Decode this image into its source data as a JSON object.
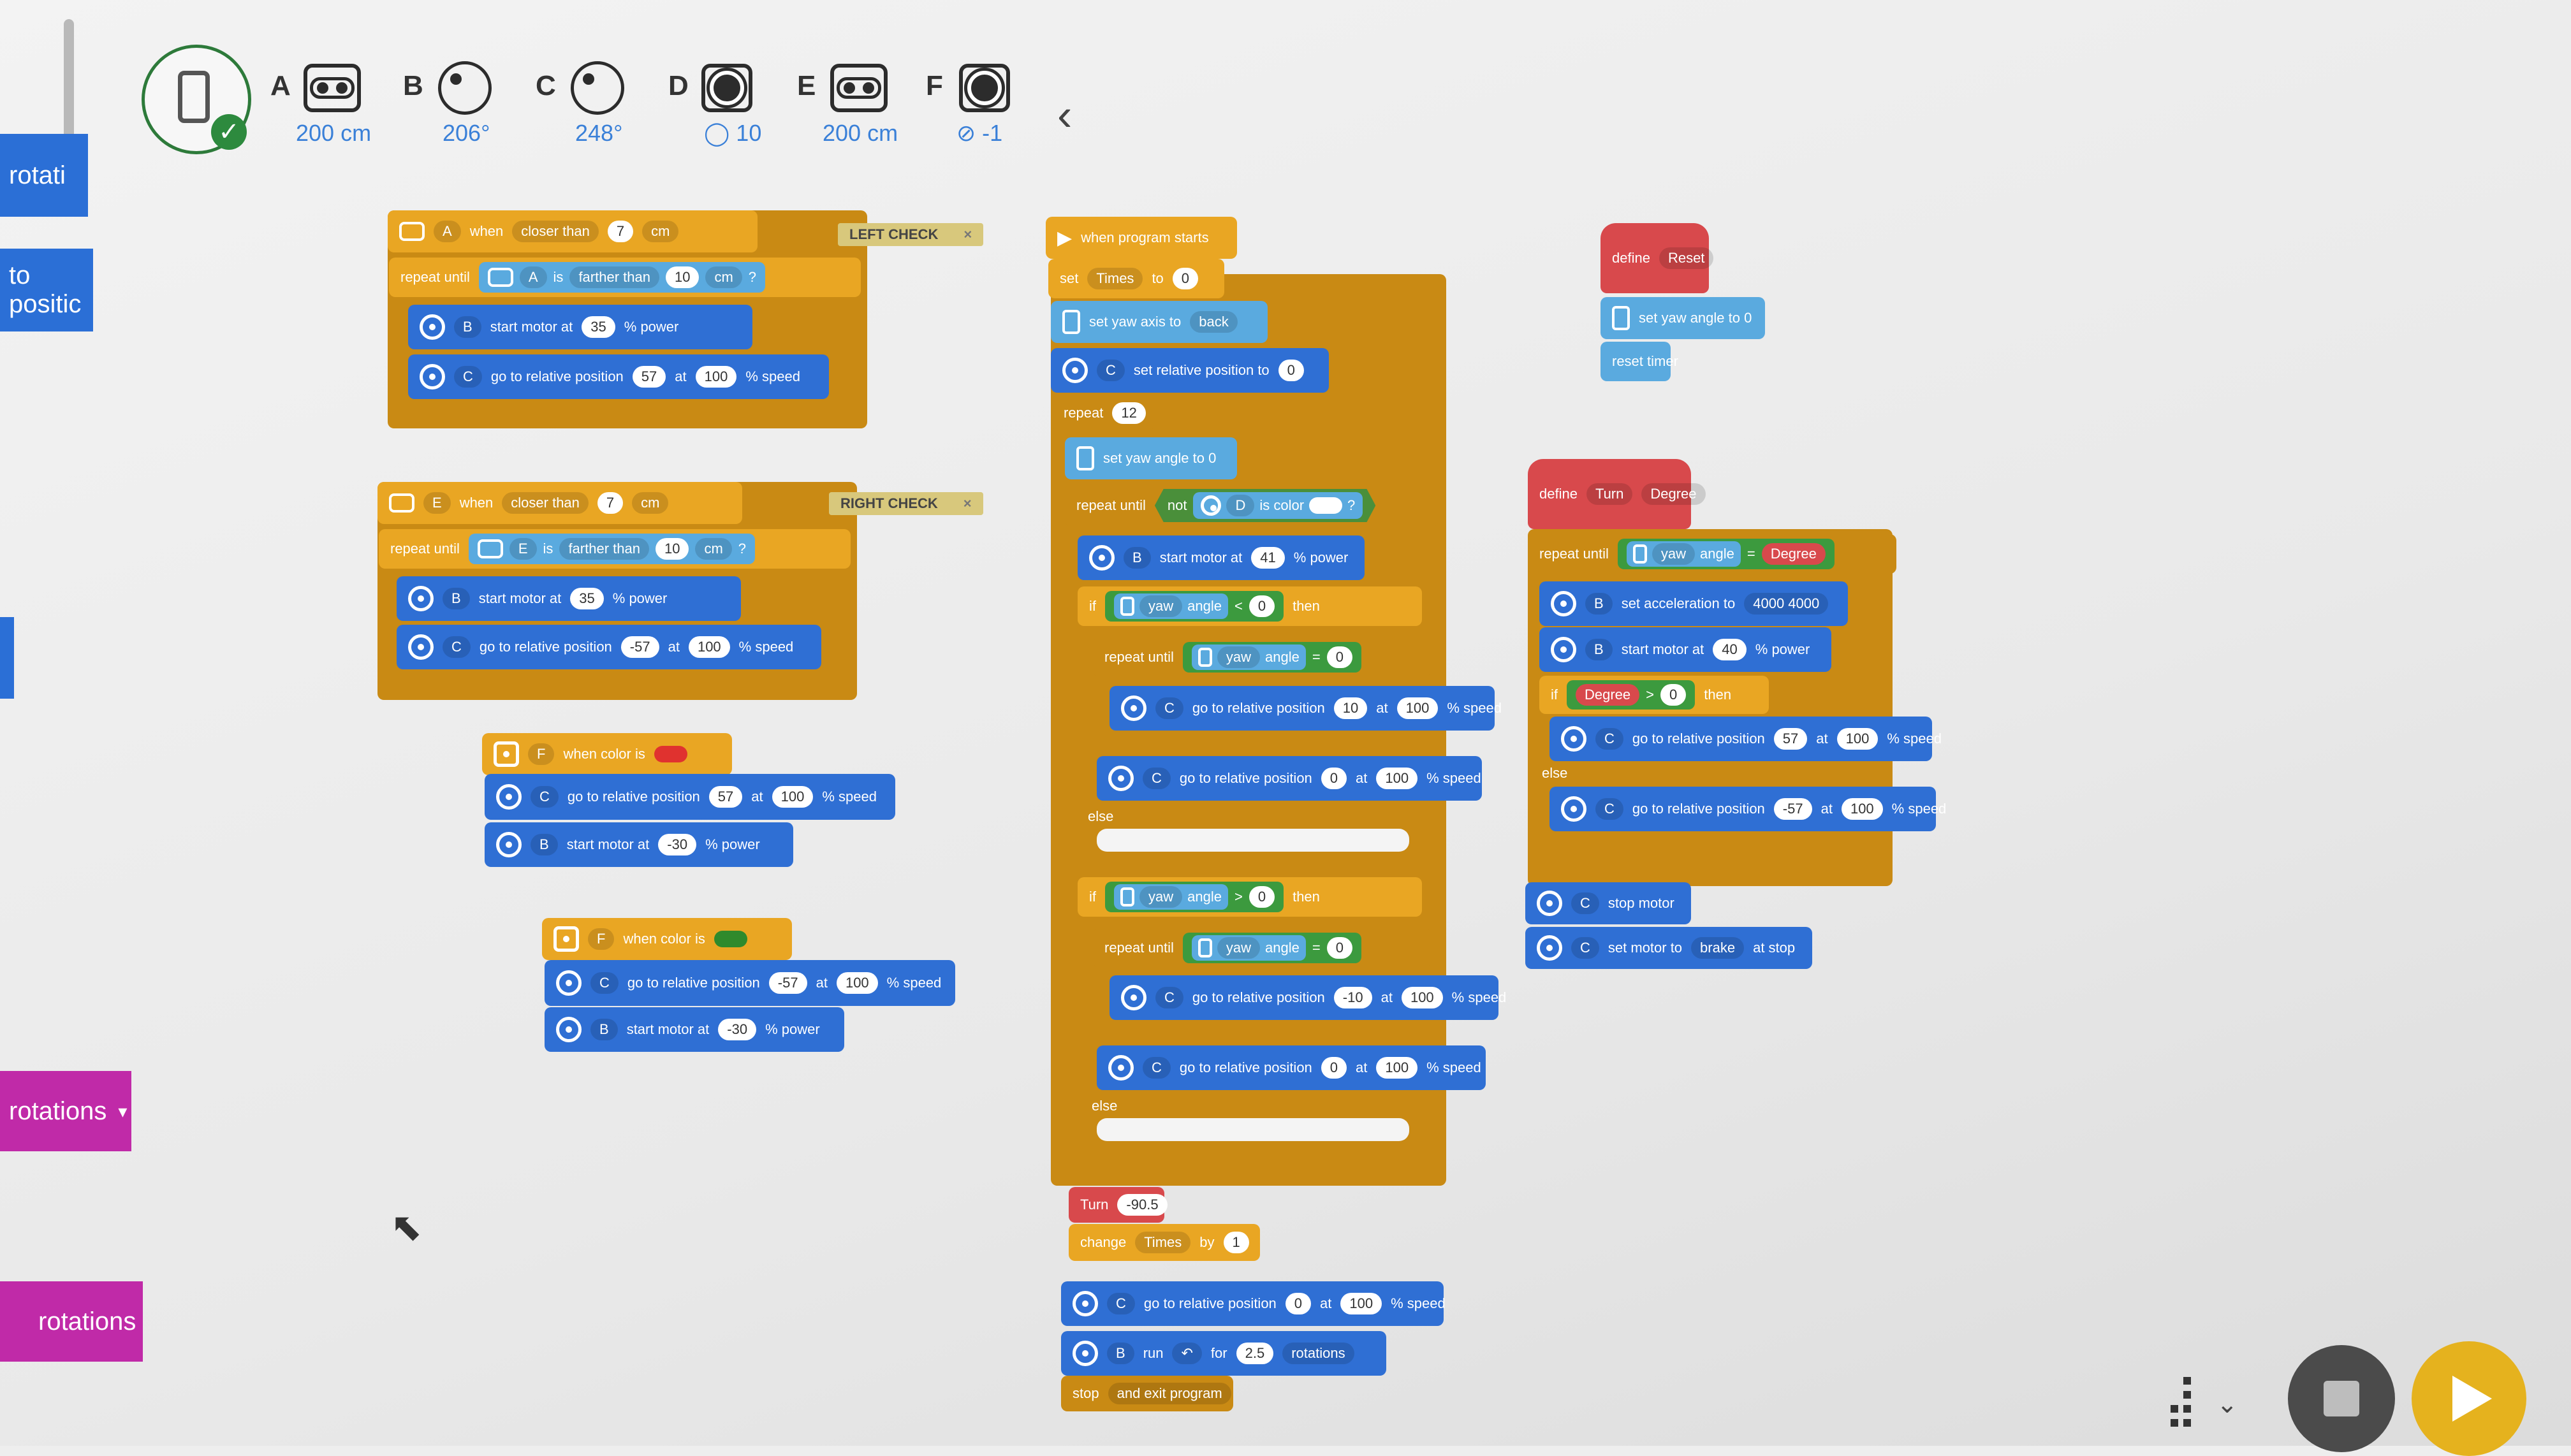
{
  "palette": {
    "top_left_1": "rotati",
    "top_left_2": "to positic",
    "bottom_1": "rotations",
    "bottom_2": "rotations"
  },
  "hub": {
    "check": "✓"
  },
  "ports": [
    {
      "label": "A",
      "icon": "distance-sensor-icon",
      "value": "200 cm"
    },
    {
      "label": "B",
      "icon": "motor-icon",
      "value": "206°"
    },
    {
      "label": "C",
      "icon": "motor-icon",
      "value": "248°"
    },
    {
      "label": "D",
      "icon": "color-sensor-icon",
      "value": "◯ 10"
    },
    {
      "label": "E",
      "icon": "distance-sensor-icon",
      "value": "200 cm"
    },
    {
      "label": "F",
      "icon": "color-sensor-icon",
      "value": "⊘ -1"
    }
  ],
  "collapse_glyph": "‹",
  "left_check": {
    "header": {
      "port": "A",
      "when": "when",
      "cond": "closer than",
      "num": "7",
      "unit": "cm"
    },
    "tag": "LEFT CHECK",
    "repeat": {
      "label": "repeat until",
      "port": "A",
      "is": "is",
      "cond": "farther than",
      "num": "10",
      "unit": "cm",
      "q": "?"
    },
    "line1": {
      "port": "B",
      "text": "start motor at",
      "num": "35",
      "suffix": "% power"
    },
    "line2": {
      "port": "C",
      "text": "go to relative position",
      "num": "57",
      "at": "at",
      "speed": "100",
      "suffix": "% speed"
    }
  },
  "right_check": {
    "header": {
      "port": "E",
      "when": "when",
      "cond": "closer than",
      "num": "7",
      "unit": "cm"
    },
    "tag": "RIGHT CHECK",
    "repeat": {
      "label": "repeat until",
      "port": "E",
      "is": "is",
      "cond": "farther than",
      "num": "10",
      "unit": "cm",
      "q": "?"
    },
    "line1": {
      "port": "B",
      "text": "start motor at",
      "num": "35",
      "suffix": "% power"
    },
    "line2": {
      "port": "C",
      "text": "go to relative position",
      "num": "-57",
      "at": "at",
      "speed": "100",
      "suffix": "% speed"
    }
  },
  "color_red": {
    "header": {
      "port": "F",
      "text": "when color is"
    },
    "line1": {
      "port": "C",
      "text": "go to relative position",
      "num": "57",
      "at": "at",
      "speed": "100",
      "suffix": "% speed"
    },
    "line2": {
      "port": "B",
      "text": "start motor at",
      "num": "-30",
      "suffix": "% power"
    }
  },
  "color_green": {
    "header": {
      "port": "F",
      "text": "when color is"
    },
    "line1": {
      "port": "C",
      "text": "go to relative position",
      "num": "-57",
      "at": "at",
      "speed": "100",
      "suffix": "% speed"
    },
    "line2": {
      "port": "B",
      "text": "start motor at",
      "num": "-30",
      "suffix": "% power"
    }
  },
  "main": {
    "start": "when program starts",
    "set": {
      "label": "set",
      "var": "Times",
      "to": "to",
      "val": "0"
    },
    "yaw_axis": {
      "text": "set yaw axis to",
      "val": "back"
    },
    "rel_pos": {
      "port": "C",
      "text": "set relative position to",
      "val": "0"
    },
    "repeat": {
      "label": "repeat",
      "val": "12"
    },
    "yaw_zero": "set yaw angle to 0",
    "repeat_until_not": {
      "label": "repeat until",
      "not": "not",
      "port": "D",
      "is": "is color",
      "q": "?"
    },
    "motor41": {
      "port": "B",
      "text": "start motor at",
      "num": "41",
      "suffix": "% power"
    },
    "if1": {
      "label": "if",
      "yaw": "yaw",
      "angle": "angle",
      "op": "<",
      "val": "0",
      "then": "then"
    },
    "ru1": {
      "label": "repeat until",
      "yaw": "yaw",
      "angle": "angle",
      "op": "=",
      "val": "0"
    },
    "pos1": {
      "port": "C",
      "text": "go to relative position",
      "num": "10",
      "at": "at",
      "speed": "100",
      "suffix": "% speed"
    },
    "pos2": {
      "port": "C",
      "text": "go to relative position",
      "num": "0",
      "at": "at",
      "speed": "100",
      "suffix": "% speed"
    },
    "else1": "else",
    "if2": {
      "label": "if",
      "yaw": "yaw",
      "angle": "angle",
      "op": ">",
      "val": "0",
      "then": "then"
    },
    "ru2": {
      "label": "repeat until",
      "yaw": "yaw",
      "angle": "angle",
      "op": "=",
      "val": "0"
    },
    "pos3": {
      "port": "C",
      "text": "go to relative position",
      "num": "-10",
      "at": "at",
      "speed": "100",
      "suffix": "% speed"
    },
    "pos4": {
      "port": "C",
      "text": "go to relative position",
      "num": "0",
      "at": "at",
      "speed": "100",
      "suffix": "% speed"
    },
    "else2": "else",
    "turn": {
      "label": "Turn",
      "val": "-90.5"
    },
    "change": {
      "label": "change",
      "var": "Times",
      "by": "by",
      "val": "1"
    },
    "pos5": {
      "port": "C",
      "text": "go to relative position",
      "num": "0",
      "at": "at",
      "speed": "100",
      "suffix": "% speed"
    },
    "run": {
      "port": "B",
      "text": "run",
      "dir": "↶",
      "for": "for",
      "num": "2.5",
      "unit": "rotations"
    },
    "stop": {
      "label": "stop",
      "val": "and exit program"
    }
  },
  "reset_fn": {
    "define": "define",
    "name": "Reset",
    "yaw": "set yaw angle to 0",
    "timer": "reset timer"
  },
  "turn_fn": {
    "define": "define",
    "name": "Turn",
    "param": "Degree",
    "ru": {
      "label": "repeat until",
      "yaw": "yaw",
      "angle": "angle",
      "op": "=",
      "param": "Degree"
    },
    "accel": {
      "port": "B",
      "text": "set acceleration to",
      "val": "4000 4000"
    },
    "motor": {
      "port": "B",
      "text": "start motor at",
      "num": "40",
      "suffix": "% power"
    },
    "if": {
      "label": "if",
      "param": "Degree",
      "op": ">",
      "val": "0",
      "then": "then"
    },
    "pos1": {
      "port": "C",
      "text": "go to relative position",
      "num": "57",
      "at": "at",
      "speed": "100",
      "suffix": "% speed"
    },
    "else": "else",
    "pos2": {
      "port": "C",
      "text": "go to relative position",
      "num": "-57",
      "at": "at",
      "speed": "100",
      "suffix": "% speed"
    },
    "stop": {
      "port": "C",
      "text": "stop motor"
    },
    "brake": {
      "port": "C",
      "text": "set motor to",
      "val": "brake",
      "suffix": "at stop"
    }
  },
  "colors": {
    "accent_blue": "#2f6fd4",
    "events_yellow": "#e9a623",
    "control_orange": "#c98a14",
    "myblocks_red": "#d8494c",
    "operator_green": "#3c9a3e"
  }
}
